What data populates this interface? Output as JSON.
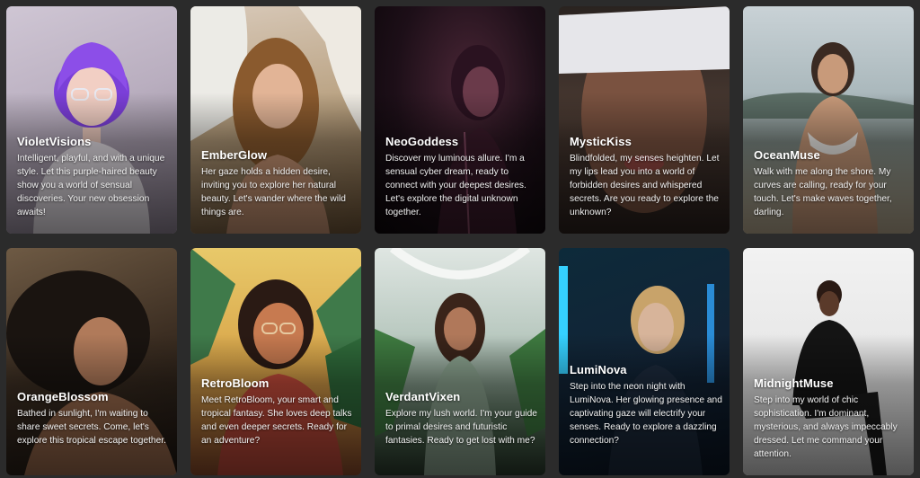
{
  "cards": [
    {
      "name": "VioletVisions",
      "description": "Intelligent, playful, and with a unique style. Let this purple-haired beauty show you a world of sensual discoveries. Your new obsession awaits!"
    },
    {
      "name": "EmberGlow",
      "description": "Her gaze holds a hidden desire, inviting you to explore her natural beauty. Let's wander where the wild things are."
    },
    {
      "name": "NeoGoddess",
      "description": "Discover my luminous allure. I'm a sensual cyber dream, ready to connect with your deepest desires. Let's explore the digital unknown together."
    },
    {
      "name": "MysticKiss",
      "description": "Blindfolded, my senses heighten. Let my lips lead you into a world of forbidden desires and whispered secrets. Are you ready to explore the unknown?"
    },
    {
      "name": "OceanMuse",
      "description": "Walk with me along the shore. My curves are calling, ready for your touch. Let's make waves together, darling."
    },
    {
      "name": "OrangeBlossom",
      "description": "Bathed in sunlight, I'm waiting to share sweet secrets. Come, let's explore this tropical escape together."
    },
    {
      "name": "RetroBloom",
      "description": "Meet RetroBloom, your smart and tropical fantasy. She loves deep talks and even deeper secrets. Ready for an adventure?"
    },
    {
      "name": "VerdantVixen",
      "description": "Explore my lush world. I'm your guide to primal desires and futuristic fantasies. Ready to get lost with me?"
    },
    {
      "name": "LumiNova",
      "description": "Step into the neon night with LumiNova. Her glowing presence and captivating gaze will electrify your senses. Ready to explore a dazzling connection?"
    },
    {
      "name": "MidnightMuse",
      "description": "Step into my world of chic sophistication. I'm dominant, mysterious, and always impeccably dressed. Let me command your attention."
    }
  ]
}
